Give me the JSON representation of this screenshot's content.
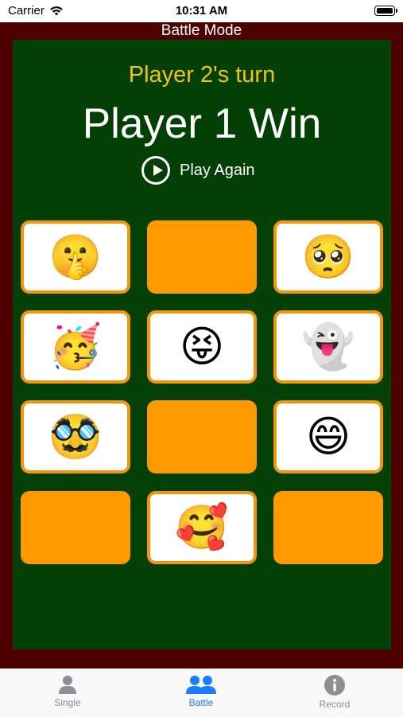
{
  "status_bar": {
    "carrier": "Carrier",
    "time": "10:31 AM"
  },
  "header": {
    "title": "Battle Mode"
  },
  "game": {
    "turn": "Player 2's turn",
    "result": "Player 1 Win",
    "play_again_label": "Play Again"
  },
  "cards": [
    {
      "state": "face-up",
      "emoji": "🤫",
      "name": "shushing-face"
    },
    {
      "state": "face-down",
      "emoji": "",
      "name": "hidden"
    },
    {
      "state": "face-up",
      "emoji": "🥺",
      "name": "pleading-face"
    },
    {
      "state": "face-up",
      "emoji": "🥳",
      "name": "partying-face"
    },
    {
      "state": "face-up",
      "emoji": "😝",
      "name": "squinting-tongue-face"
    },
    {
      "state": "face-up",
      "emoji": "👻",
      "name": "ghost"
    },
    {
      "state": "face-up",
      "emoji": "🥸",
      "name": "disguised-face"
    },
    {
      "state": "face-down",
      "emoji": "",
      "name": "hidden"
    },
    {
      "state": "face-up",
      "emoji": "😄",
      "name": "grinning-face"
    },
    {
      "state": "face-down",
      "emoji": "",
      "name": "hidden"
    },
    {
      "state": "face-up",
      "emoji": "🥰",
      "name": "smiling-face-with-hearts"
    },
    {
      "state": "face-down",
      "emoji": "",
      "name": "hidden"
    }
  ],
  "tabs": [
    {
      "label": "Single",
      "icon": "person-icon",
      "active": false
    },
    {
      "label": "Battle",
      "icon": "two-persons-icon",
      "active": true
    },
    {
      "label": "Record",
      "icon": "info-icon",
      "active": false
    }
  ],
  "colors": {
    "frame": "#4d0000",
    "board": "#034005",
    "turn_text": "#f2c40f",
    "card_back": "#ff9900",
    "card_border": "#f5960a",
    "tab_active": "#1a7cff",
    "tab_inactive": "#8e8e93"
  }
}
